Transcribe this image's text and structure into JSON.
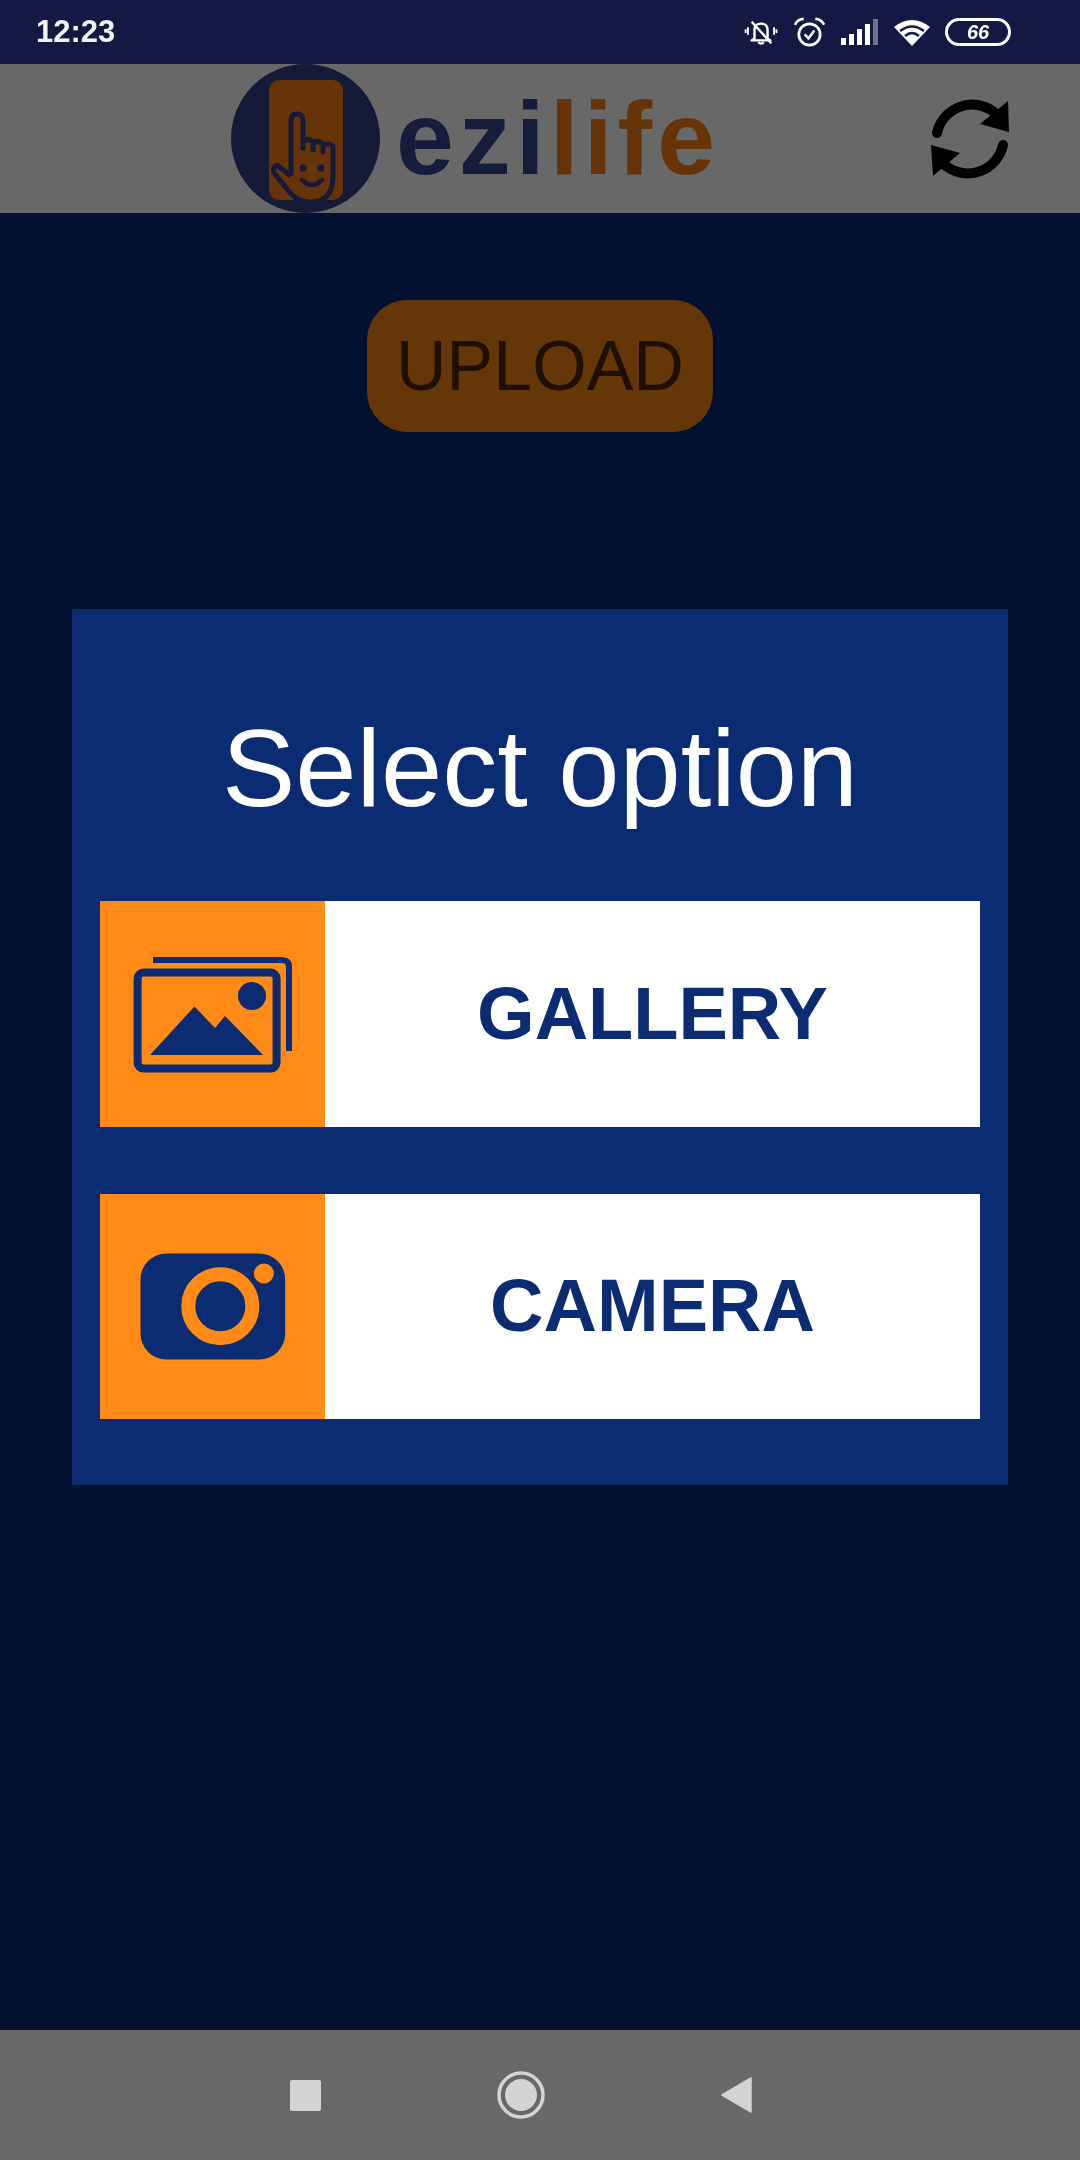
{
  "status_bar": {
    "time": "12:23",
    "battery": "66"
  },
  "header": {
    "logo": {
      "parts": [
        {
          "text": "ezi",
          "color": "#161c3c"
        },
        {
          "text": "life",
          "color": "#663408"
        }
      ]
    }
  },
  "upload_button": {
    "label": "UPLOAD"
  },
  "dialog": {
    "title": "Select option",
    "options": [
      {
        "kind": "gallery",
        "label": "GALLERY"
      },
      {
        "kind": "camera",
        "label": "CAMERA"
      }
    ]
  }
}
